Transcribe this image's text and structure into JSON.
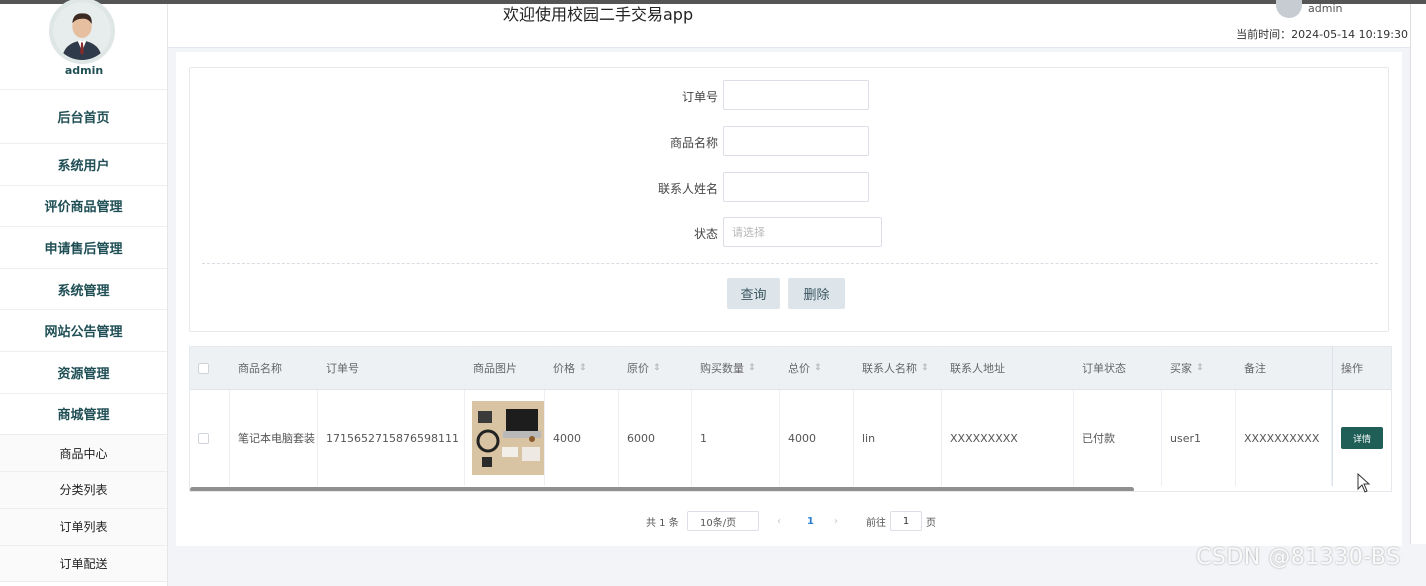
{
  "header": {
    "title": "欢迎使用校园二手交易app",
    "user": "admin",
    "time_label": "当前时间：",
    "time_value": "2024-05-14 10:19:30"
  },
  "sidebar": {
    "user": "admin",
    "items": [
      {
        "label": "后台首页"
      },
      {
        "label": "系统用户"
      },
      {
        "label": "评价商品管理"
      },
      {
        "label": "申请售后管理"
      },
      {
        "label": "系统管理"
      },
      {
        "label": "网站公告管理"
      },
      {
        "label": "资源管理"
      },
      {
        "label": "商城管理"
      }
    ],
    "sub_items": [
      {
        "label": "商品中心"
      },
      {
        "label": "分类列表"
      },
      {
        "label": "订单列表"
      },
      {
        "label": "订单配送"
      }
    ]
  },
  "search": {
    "order_no_label": "订单号",
    "order_no_value": "",
    "product_name_label": "商品名称",
    "product_name_value": "",
    "contact_name_label": "联系人姓名",
    "contact_name_value": "",
    "status_label": "状态",
    "status_placeholder": "请选择",
    "query_button": "查询",
    "delete_button": "删除"
  },
  "table": {
    "columns": [
      "商品名称",
      "订单号",
      "商品图片",
      "价格",
      "原价",
      "购买数量",
      "总价",
      "联系人名称",
      "联系人地址",
      "订单状态",
      "买家",
      "备注",
      "操作"
    ],
    "rows": [
      {
        "product_name": "笔记本电脑套装",
        "order_no": "1715652715876598111",
        "price": "4000",
        "original_price": "6000",
        "quantity": "1",
        "total": "4000",
        "contact_name": "lin",
        "contact_address": "XXXXXXXXX",
        "status": "已付款",
        "buyer": "user1",
        "remark": "XXXXXXXXXX",
        "action": "详情"
      }
    ]
  },
  "pagination": {
    "total": "共 1 条",
    "page_size": "10条/页",
    "current_page": "1",
    "goto_label": "前往",
    "goto_value": "1",
    "page_suffix": "页"
  },
  "watermark": "CSDN @81330-BS",
  "colors": {
    "menu_text": "#1f4f55",
    "detail_button": "#1f5f58",
    "button_bg": "#dde5ea",
    "page_active": "#2b7fd3"
  }
}
